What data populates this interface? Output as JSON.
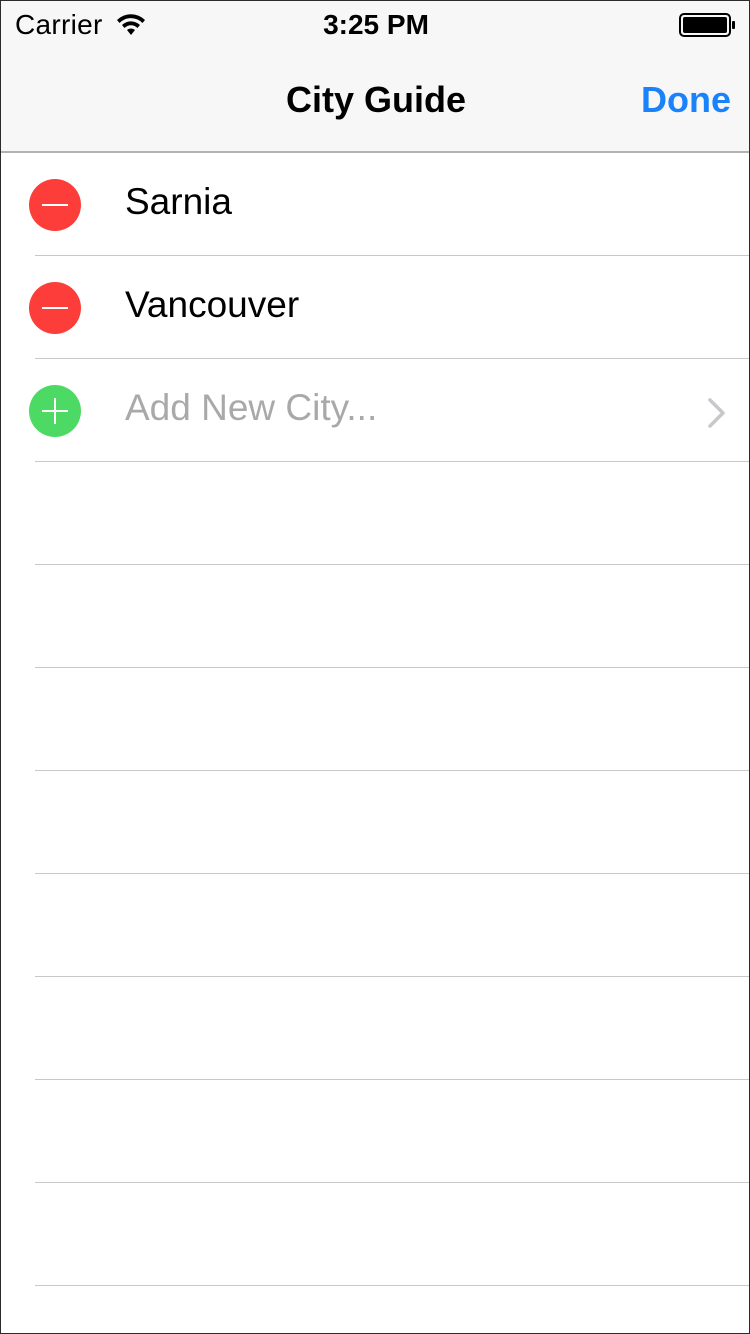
{
  "status_bar": {
    "carrier": "Carrier",
    "time": "3:25 PM",
    "wifi_icon": "wifi-icon",
    "battery_icon": "battery-icon",
    "battery_level": 1.0
  },
  "nav_bar": {
    "title": "City Guide",
    "done_label": "Done"
  },
  "colors": {
    "accent": "#1a82fb",
    "delete": "#fc3d39",
    "insert": "#4cd964",
    "placeholder": "#a9a9a9"
  },
  "cities": [
    {
      "name": "Sarnia",
      "control_icon": "minus-icon"
    },
    {
      "name": "Vancouver",
      "control_icon": "minus-icon"
    }
  ],
  "add_row": {
    "label": "Add New City...",
    "control_icon": "plus-icon",
    "accessory_icon": "chevron-right-icon"
  }
}
